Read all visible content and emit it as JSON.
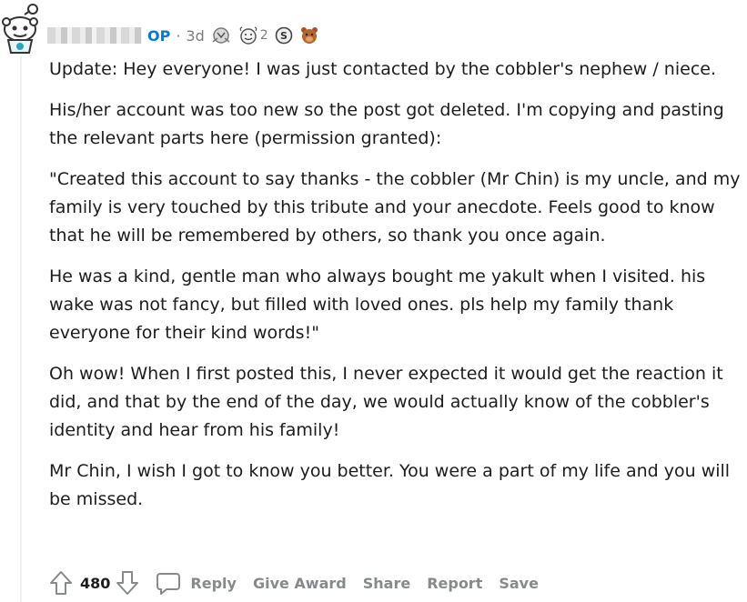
{
  "comment": {
    "author_flair": "OP",
    "separator": "·",
    "age": "3d",
    "awards": [
      {
        "icon": "silver-award-icon",
        "count": ""
      },
      {
        "icon": "wholesome-award-icon",
        "count": "2"
      },
      {
        "icon": "helpful-award-icon",
        "count": ""
      },
      {
        "icon": "bear-award-icon",
        "count": ""
      }
    ],
    "paragraphs": [
      "Update: Hey everyone! I was just contacted by the cobbler's nephew / niece.",
      "His/her account was too new so the post got deleted. I'm copying and pasting the relevant parts here (permission granted):",
      "\"Created this account to say thanks - the cobbler (Mr Chin) is my uncle, and my family is very touched by this tribute and your anecdote. Feels good to know that he will be remembered by others, so thank you once again.",
      "He was a kind, gentle man who always bought me yakult when I visited. his wake was not fancy, but filled with loved ones. pls help my family thank everyone for their kind words!\"",
      "Oh wow! When I first posted this, I never expected it would get the reaction it did, and that by the end of the day, we would actually know of the cobbler's identity and hear from his family!",
      "Mr Chin, I wish I got to know you better. You were a part of my life and you will be missed."
    ]
  },
  "actions": {
    "score": "480",
    "reply": "Reply",
    "give_award": "Give Award",
    "share": "Share",
    "report": "Report",
    "save": "Save"
  },
  "colors": {
    "op_blue": "#0079d3",
    "meta_gray": "#7c7c7c",
    "action_gray": "#878a8c",
    "text": "#1c1c1c"
  }
}
